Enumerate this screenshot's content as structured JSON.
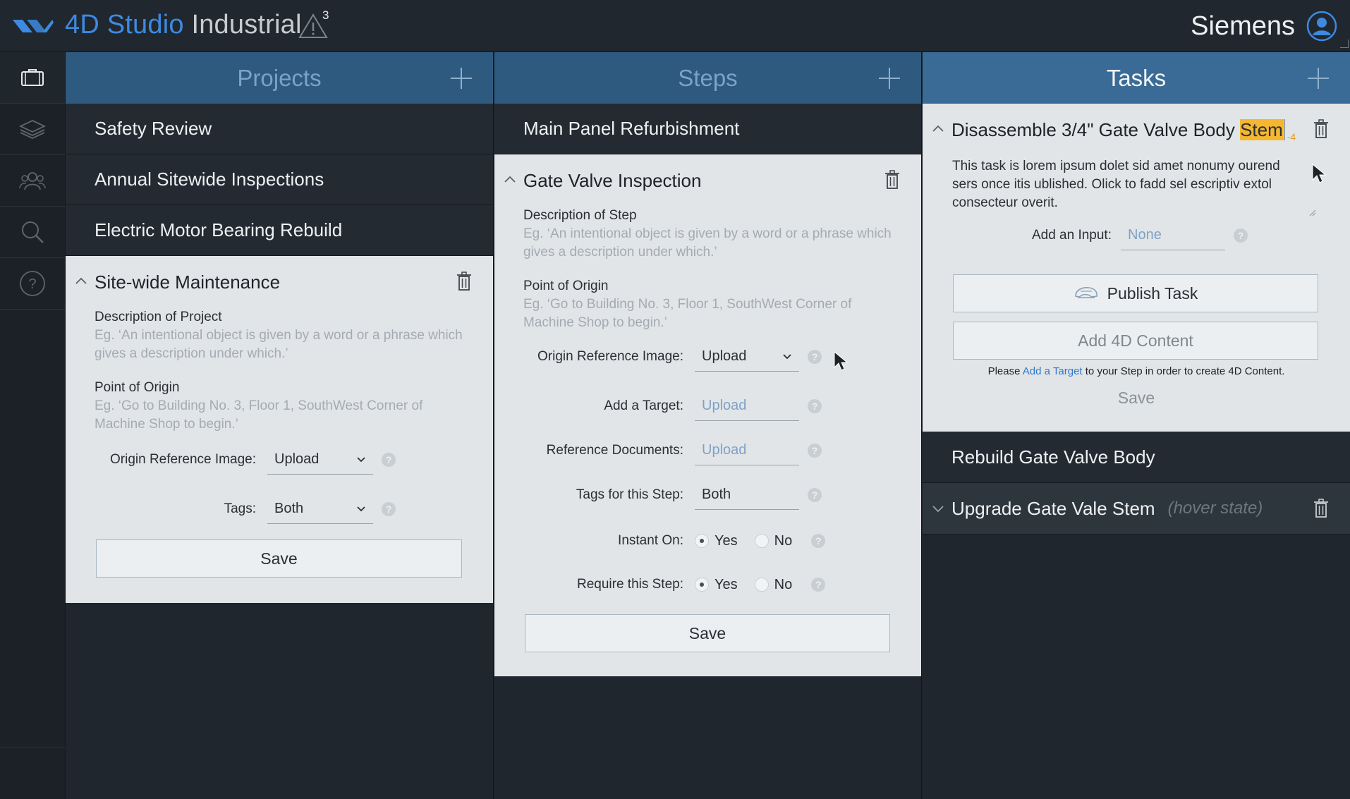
{
  "app": {
    "brand": "4D Studio",
    "name": " Industrial",
    "alert_count": "3",
    "user": "Siemens"
  },
  "rail": {
    "icons": [
      "briefcase-icon",
      "layers-icon",
      "users-icon",
      "search-icon",
      "help-icon"
    ]
  },
  "projects": {
    "header": "Projects",
    "items": [
      "Safety Review",
      "Annual Sitewide Inspections",
      "Electric Motor Bearing Rebuild"
    ],
    "expanded": {
      "title": "Site-wide Maintenance",
      "description_label": "Description of Project",
      "description_hint": "Eg. ‘An intentional object is given by a word or a phrase which gives a description under which.’",
      "origin_label": "Point of Origin",
      "origin_hint": "Eg. ‘Go to Building No. 3, Floor 1, SouthWest Corner of Machine Shop to begin.’",
      "ref_image_label": "Origin Reference Image:",
      "ref_image_value": "Upload",
      "tags_label": "Tags:",
      "tags_value": "Both",
      "save_label": "Save"
    }
  },
  "steps": {
    "header": "Steps",
    "items": [
      "Main Panel Refurbishment"
    ],
    "expanded": {
      "title": "Gate Valve Inspection",
      "description_label": "Description of Step",
      "description_hint": "Eg. ‘An intentional object is given by a word or a phrase which gives a description under which.’",
      "origin_label": "Point of Origin",
      "origin_hint": "Eg. ‘Go to Building No. 3, Floor 1, SouthWest Corner of Machine Shop to begin.’",
      "ref_image_label": "Origin Reference Image:",
      "ref_image_value": "Upload",
      "target_label": "Add a Target:",
      "target_value": "Upload",
      "ref_docs_label": "Reference Documents:",
      "ref_docs_value": "Upload",
      "tags_label": "Tags for this Step:",
      "tags_value": "Both",
      "instant_on_label": "Instant On:",
      "require_label": "Require this Step:",
      "yes": "Yes",
      "no": "No",
      "save_label": "Save"
    }
  },
  "tasks": {
    "header": "Tasks",
    "expanded": {
      "title_prefix": "Disassemble 3/4\" Gate Valve Body ",
      "title_highlight": "Stem",
      "char_counter": "-4",
      "description": "This task is lorem ipsum dolet sid amet nonumy ourend sers once itis ublished. Olick to fadd sel escriptiv extol consecteur overit.",
      "input_label": "Add an Input:",
      "input_value": "None",
      "publish_label": "Publish Task",
      "add_content_label": "Add 4D Content",
      "note_before": "Please ",
      "note_link": "Add a Target",
      "note_after": " to your Step in order to create 4D Content.",
      "save_label": "Save"
    },
    "items": [
      {
        "label": "Rebuild Gate Valve Body",
        "hint": ""
      },
      {
        "label": "Upgrade Gate Vale Stem",
        "hint": "(hover state)"
      }
    ]
  },
  "colors": {
    "accent": "#3d8ae0",
    "header_blue": "#2f5a80",
    "highlight": "#f5b731",
    "panel_bg": "#e2e5e8"
  }
}
